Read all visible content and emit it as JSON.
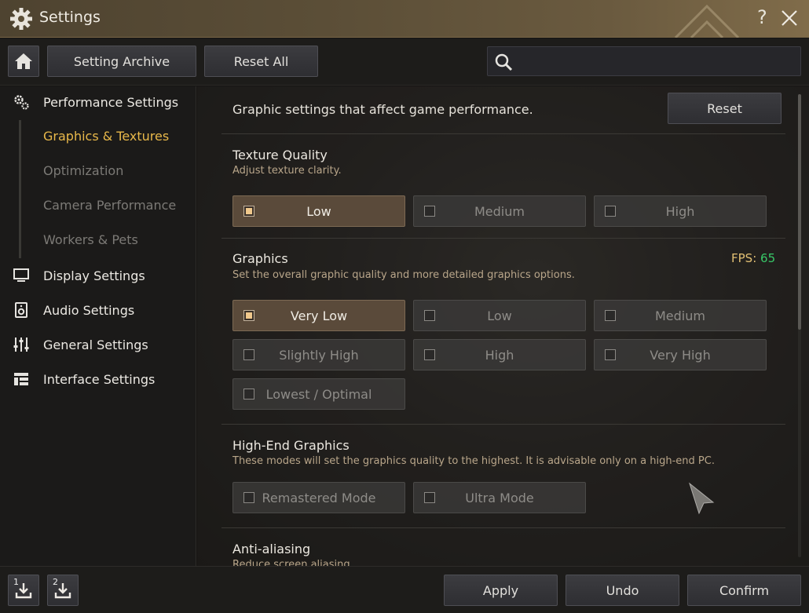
{
  "window": {
    "title": "Settings",
    "help": "?"
  },
  "toolbar": {
    "archive_label": "Setting Archive",
    "reset_all_label": "Reset All",
    "search_placeholder": "",
    "search_value": ""
  },
  "sidebar": {
    "categories": [
      {
        "label": "Performance Settings",
        "icon": "gears-icon"
      },
      {
        "label": "Display Settings",
        "icon": "monitor-icon"
      },
      {
        "label": "Audio Settings",
        "icon": "speaker-icon"
      },
      {
        "label": "General Settings",
        "icon": "sliders-icon"
      },
      {
        "label": "Interface Settings",
        "icon": "layout-icon"
      }
    ],
    "subitems": [
      {
        "label": "Graphics & Textures",
        "active": true
      },
      {
        "label": "Optimization",
        "active": false
      },
      {
        "label": "Camera Performance",
        "active": false
      },
      {
        "label": "Workers & Pets",
        "active": false
      }
    ]
  },
  "main": {
    "description": "Graphic settings that affect game performance.",
    "reset_label": "Reset",
    "texture_quality": {
      "title": "Texture Quality",
      "subtitle": "Adjust texture clarity.",
      "options": [
        "Low",
        "Medium",
        "High"
      ],
      "selected": "Low"
    },
    "graphics": {
      "title": "Graphics",
      "subtitle": "Set the overall graphic quality and more detailed graphics options.",
      "fps_label": "FPS:",
      "fps_value": "65",
      "options": [
        "Very Low",
        "Low",
        "Medium",
        "Slightly High",
        "High",
        "Very High",
        "Lowest / Optimal"
      ],
      "selected": "Very Low"
    },
    "high_end": {
      "title": "High-End Graphics",
      "subtitle": "These modes will set the graphics quality to the highest. It is advisable only on a high-end PC.",
      "options": [
        "Remastered Mode",
        "Ultra Mode"
      ]
    },
    "anti_aliasing": {
      "title": "Anti-aliasing",
      "subtitle": "Reduce screen aliasing."
    }
  },
  "bottom": {
    "slot1": "1",
    "slot2": "2",
    "apply_label": "Apply",
    "undo_label": "Undo",
    "confirm_label": "Confirm"
  },
  "colors": {
    "accent": "#e8b84a",
    "fps_value": "#38c868",
    "selected_option": "#5a4a3a",
    "title_bar": "#5b4e37"
  }
}
